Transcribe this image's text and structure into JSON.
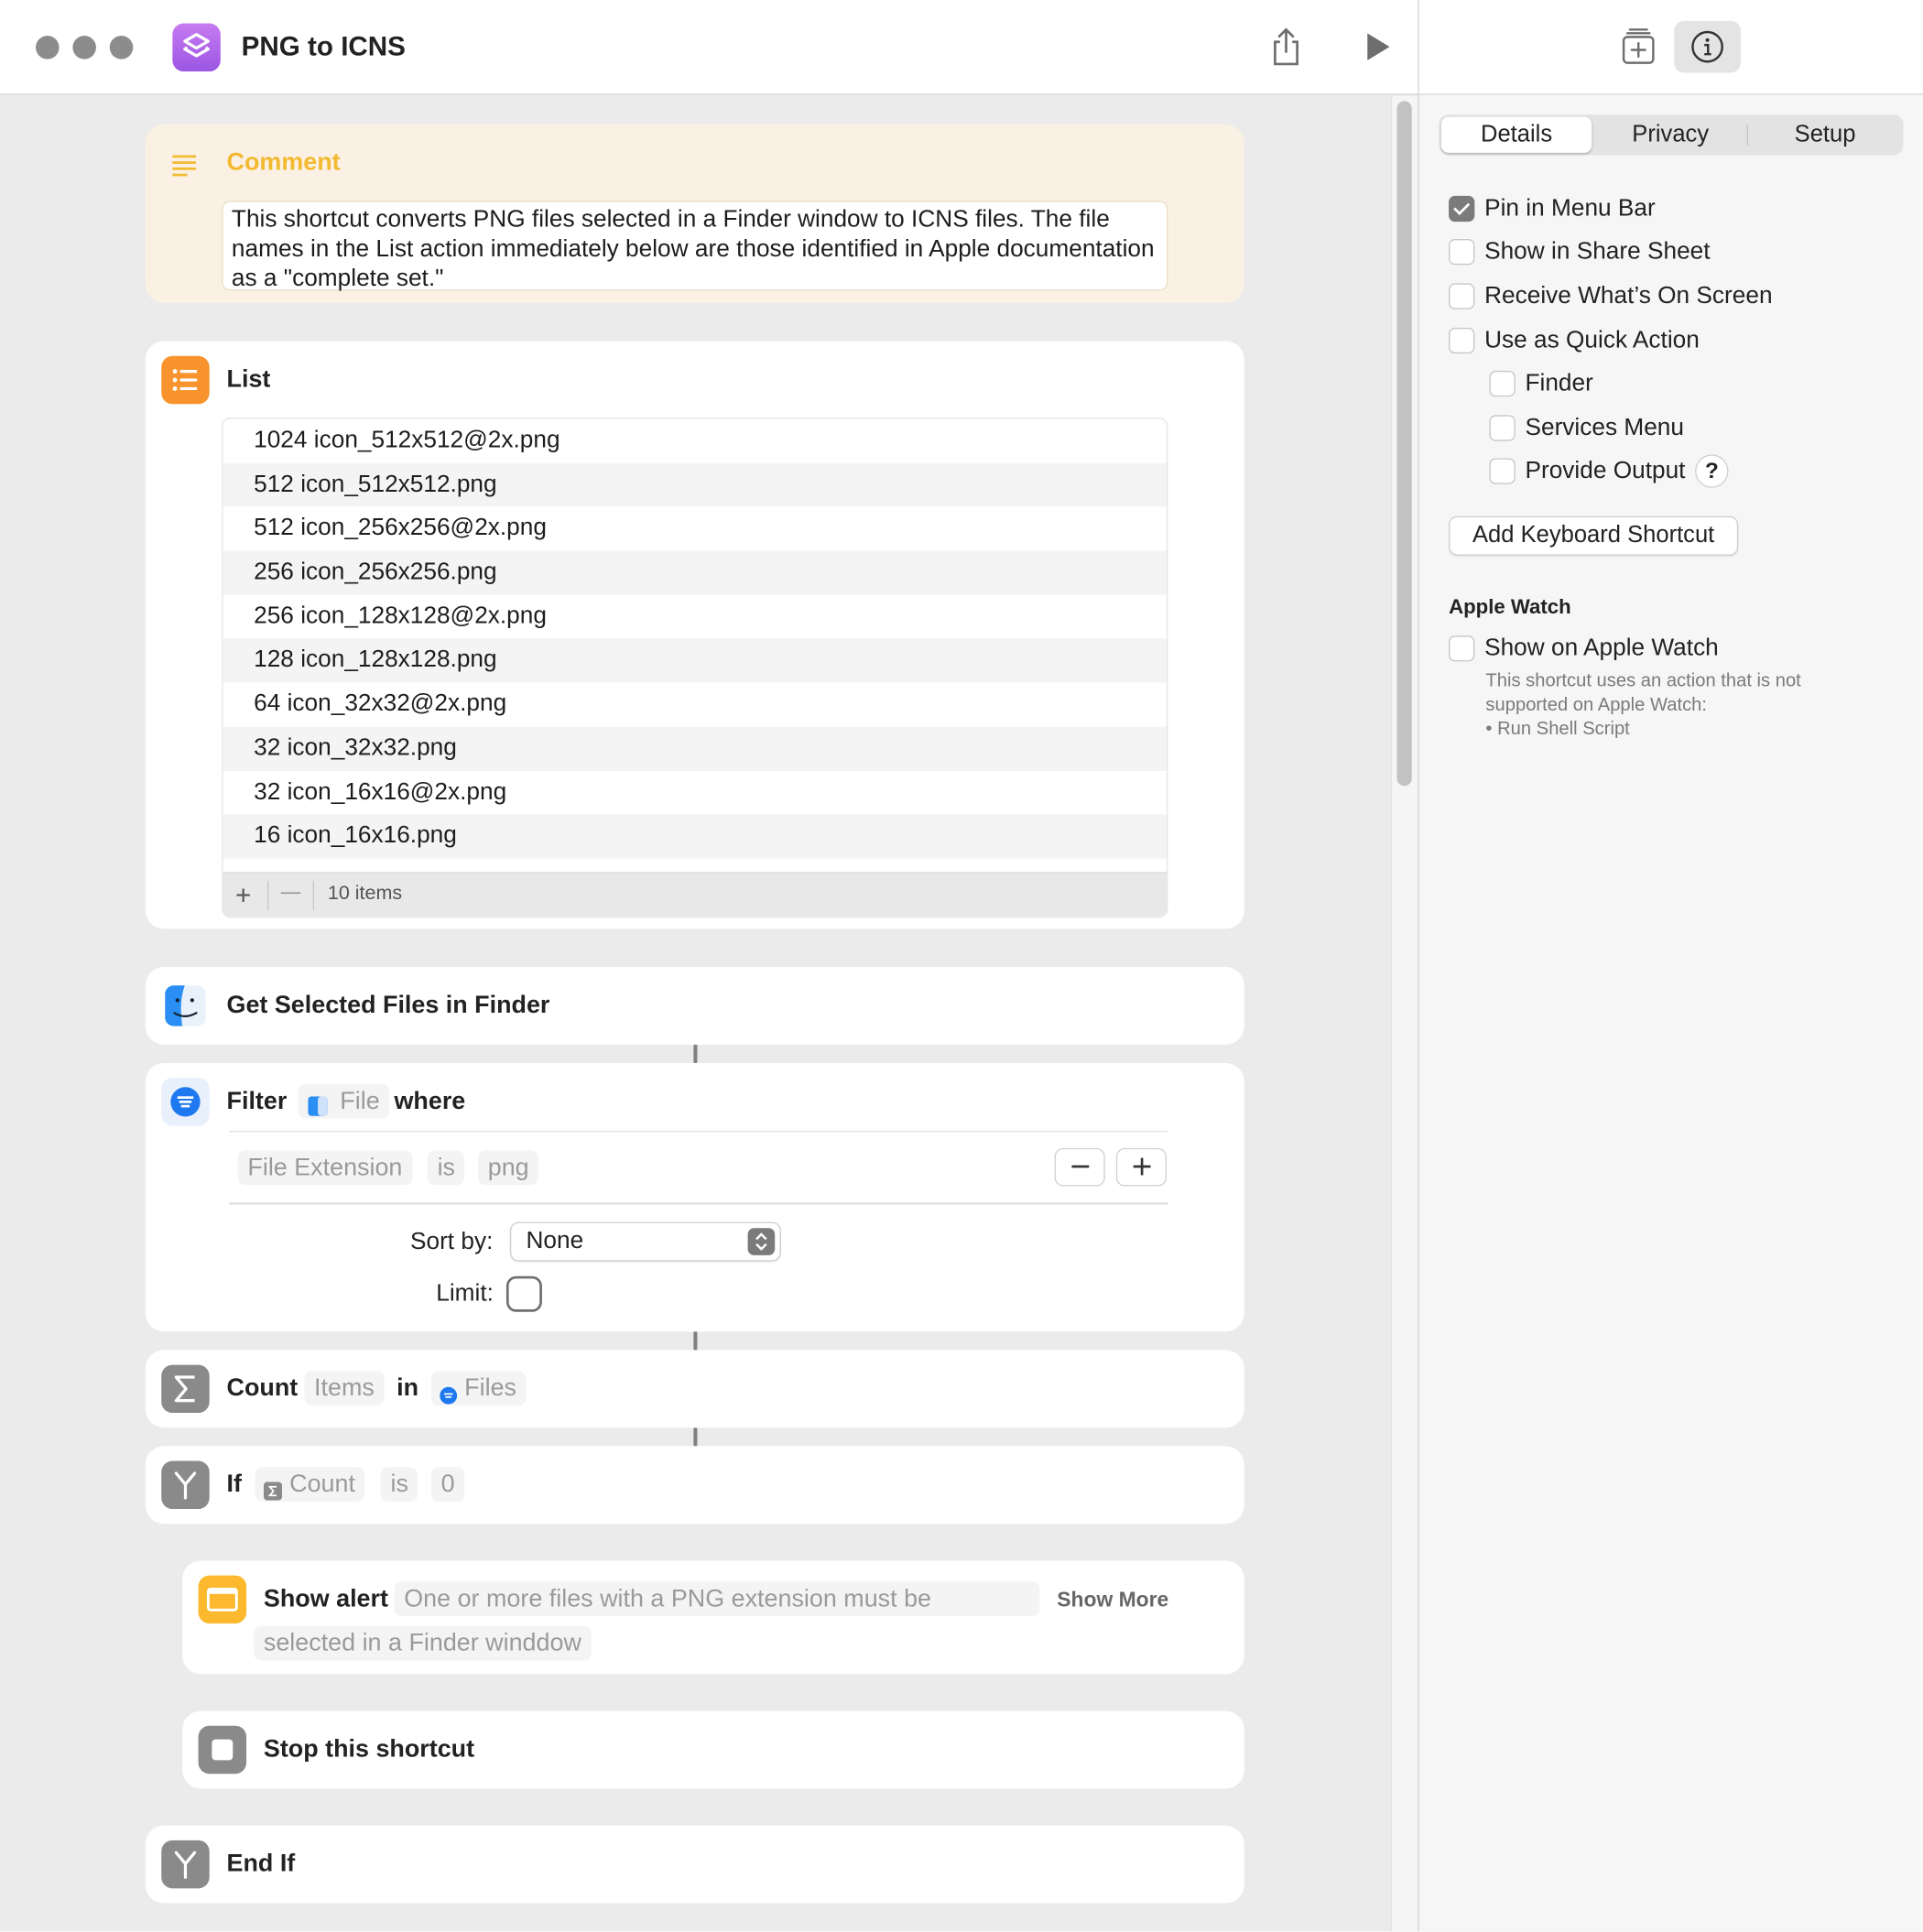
{
  "window": {
    "title": "PNG to ICNS",
    "share_icon": "share-icon",
    "run_icon": "play-icon",
    "library_icon": "add-action-icon",
    "info_icon": "info-icon"
  },
  "inspector": {
    "tabs": [
      "Details",
      "Privacy",
      "Setup"
    ],
    "selected_tab": "Details",
    "options": [
      {
        "label": "Pin in Menu Bar",
        "checked": true
      },
      {
        "label": "Show in Share Sheet",
        "checked": false
      },
      {
        "label": "Receive What’s On Screen",
        "checked": false
      },
      {
        "label": "Use as Quick Action",
        "checked": false
      }
    ],
    "quick_action_options": [
      {
        "label": "Finder",
        "checked": false
      },
      {
        "label": "Services Menu",
        "checked": false
      },
      {
        "label": "Provide Output",
        "checked": false
      }
    ],
    "help_label": "?",
    "keyboard_button": "Add Keyboard Shortcut",
    "apple_watch": {
      "heading": "Apple Watch",
      "option_label": "Show on Apple Watch",
      "checked": false,
      "note_line1": "This shortcut uses an action that is not",
      "note_line2": "supported on Apple Watch:",
      "note_line3": "• Run Shell Script"
    }
  },
  "actions": {
    "comment": {
      "title": "Comment",
      "text": "This shortcut converts PNG files selected in a Finder window to ICNS files. The file names in the List action immediately below are those identified in Apple documentation as a \"complete set.\""
    },
    "list": {
      "title": "List",
      "items": [
        "1024 icon_512x512@2x.png",
        "512 icon_512x512.png",
        "512 icon_256x256@2x.png",
        "256 icon_256x256.png",
        "256 icon_128x128@2x.png",
        "128 icon_128x128.png",
        "64 icon_32x32@2x.png",
        "32 icon_32x32.png",
        "32 icon_16x16@2x.png",
        "16 icon_16x16.png"
      ],
      "add_label": "+",
      "remove_label": "—",
      "count_label": "10 items"
    },
    "get_files": {
      "title": "Get Selected Files in Finder"
    },
    "filter": {
      "title": "Filter",
      "input": "File",
      "where": "where",
      "condition_property": "File Extension",
      "condition_operator": "is",
      "condition_value": "png",
      "remove_label": "—",
      "add_label": "+",
      "sort_label": "Sort by:",
      "sort_value": "None",
      "limit_label": "Limit:",
      "limit_on": false
    },
    "count": {
      "title": "Count",
      "type": "Items",
      "in": "in",
      "input": "Files"
    },
    "if": {
      "title": "If",
      "variable": "Count",
      "operator": "is",
      "value": "0"
    },
    "alert": {
      "title": "Show alert",
      "message_line1": "One or more files with a PNG extension must be",
      "message_line2": "selected in a Finder winddow",
      "show_more": "Show More"
    },
    "stop": {
      "title": "Stop this shortcut"
    },
    "end_if": {
      "title": "End If"
    }
  },
  "colors": {
    "comment_accent": "#f3ba2f",
    "list_icon": "#f8932d",
    "filter_icon": "#1e78ef",
    "alert_icon": "#fcb92e",
    "gray_icon": "#8a8a8a",
    "app_icon": "#a25ee8"
  }
}
